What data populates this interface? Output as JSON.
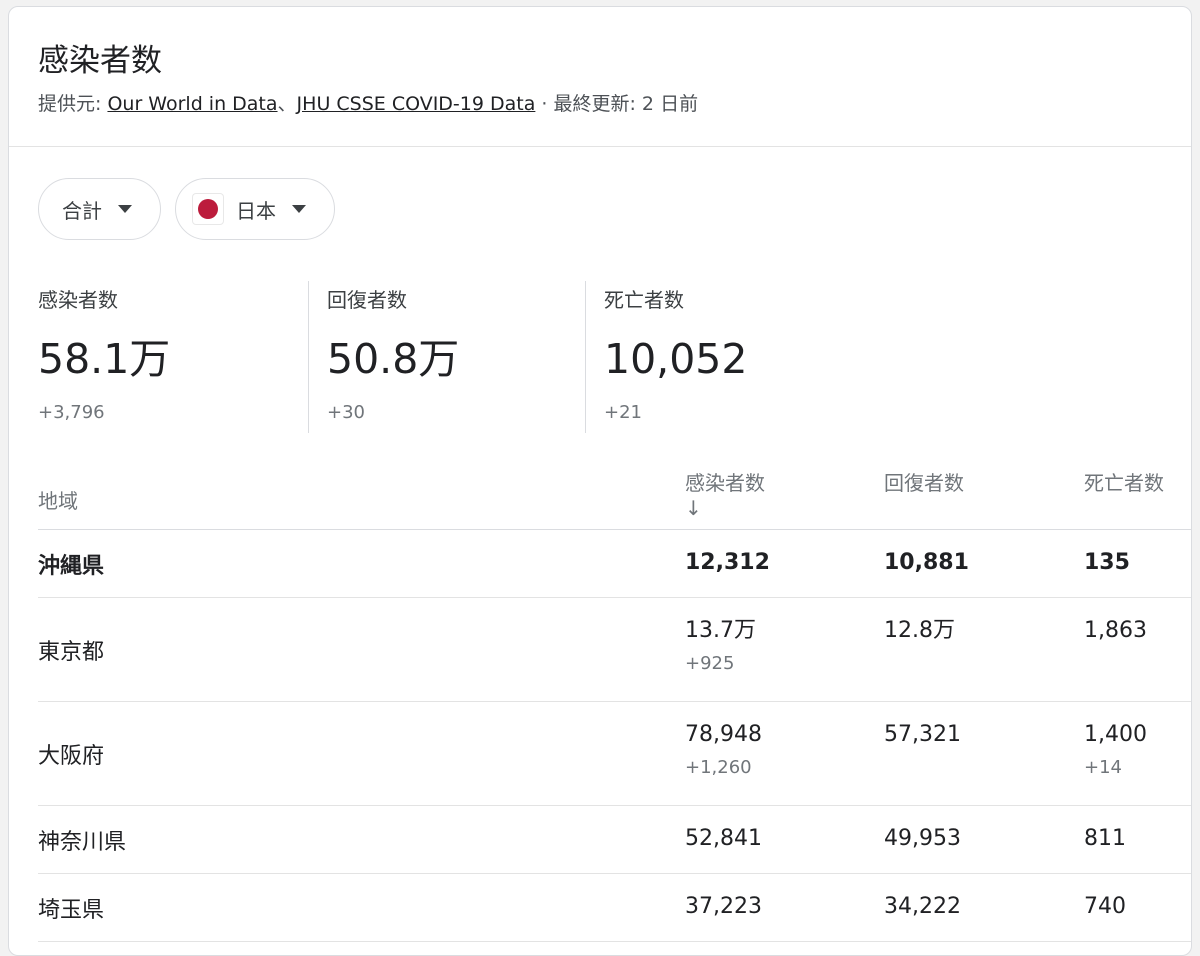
{
  "header": {
    "title": "感染者数",
    "source_prefix": "提供元: ",
    "source_link_1": "Our World in Data",
    "source_sep": "、",
    "source_link_2": "JHU CSSE COVID-19 Data",
    "updated": " · 最終更新: 2 日前"
  },
  "filters": {
    "total_label": "合計",
    "country_label": "日本"
  },
  "stats": [
    {
      "label": "感染者数",
      "value": "58.1万",
      "delta": "+3,796"
    },
    {
      "label": "回復者数",
      "value": "50.8万",
      "delta": "+30"
    },
    {
      "label": "死亡者数",
      "value": "10,052",
      "delta": "+21"
    }
  ],
  "table": {
    "headers": {
      "region": "地域",
      "cases": "感染者数↓",
      "recovered": "回復者数",
      "deaths": "死亡者数"
    },
    "rows": [
      {
        "region": "沖縄県",
        "cases": "12,312",
        "cases_delta": "",
        "recovered": "10,881",
        "deaths": "135",
        "deaths_delta": ""
      },
      {
        "region": "東京都",
        "cases": "13.7万",
        "cases_delta": "+925",
        "recovered": "12.8万",
        "deaths": "1,863",
        "deaths_delta": ""
      },
      {
        "region": "大阪府",
        "cases": "78,948",
        "cases_delta": "+1,260",
        "recovered": "57,321",
        "deaths": "1,400",
        "deaths_delta": "+14"
      },
      {
        "region": "神奈川県",
        "cases": "52,841",
        "cases_delta": "",
        "recovered": "49,953",
        "deaths": "811",
        "deaths_delta": ""
      },
      {
        "region": "埼玉県",
        "cases": "37,223",
        "cases_delta": "",
        "recovered": "34,222",
        "deaths": "740",
        "deaths_delta": ""
      }
    ]
  },
  "colors": {
    "flag_red": "#bc1c3c",
    "text_primary": "#202124",
    "text_secondary": "#70757a",
    "divider": "#dadce0"
  },
  "icons": {
    "dropdown": "caret-down-icon",
    "flag": "japan-flag-icon"
  }
}
